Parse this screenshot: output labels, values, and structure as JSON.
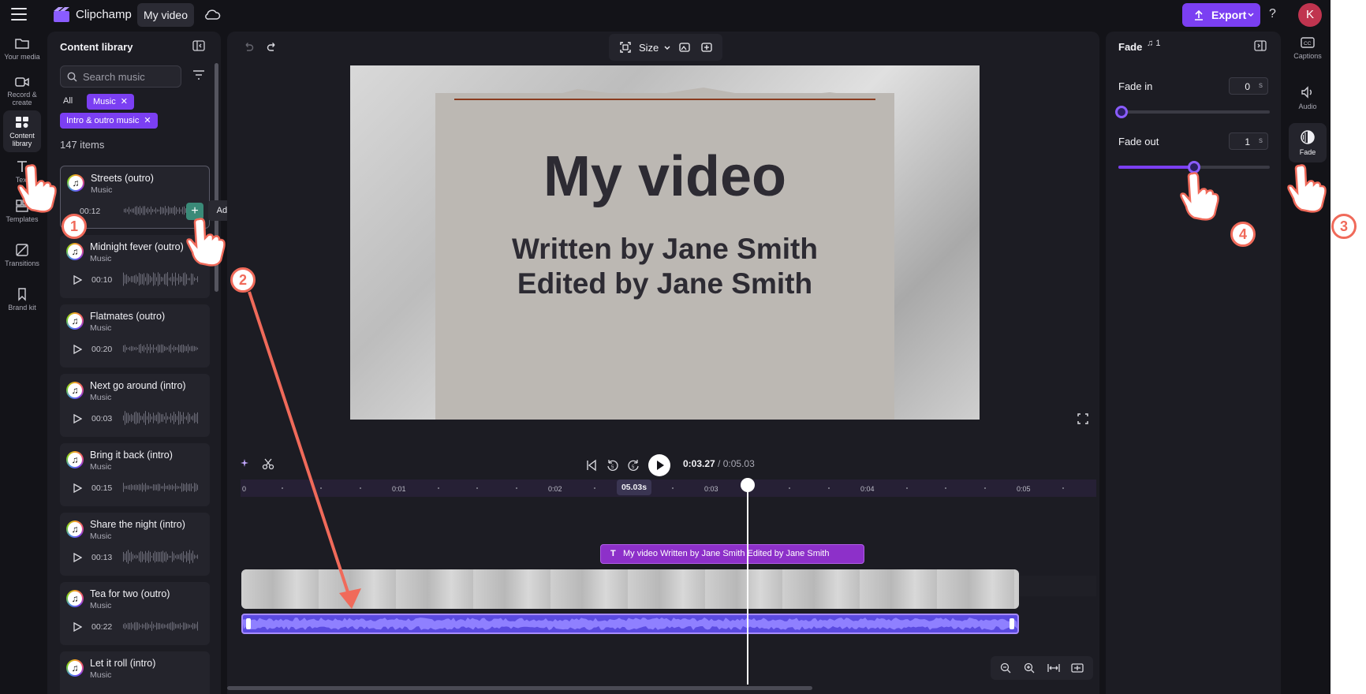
{
  "topbar": {
    "app_name": "Clipchamp",
    "project_name": "My video",
    "export_label": "Export",
    "help_label": "?",
    "avatar_initial": "K"
  },
  "left_rail": [
    {
      "label": "Your media",
      "icon": "folder-icon"
    },
    {
      "label": "Record & create",
      "icon": "camera-icon"
    },
    {
      "label": "Content library",
      "icon": "library-icon",
      "active": true
    },
    {
      "label": "Text",
      "icon": "text-icon"
    },
    {
      "label": "Templates",
      "icon": "templates-icon"
    },
    {
      "label": "Transitions",
      "icon": "transitions-icon"
    },
    {
      "label": "Brand kit",
      "icon": "brand-kit-icon"
    }
  ],
  "library": {
    "title": "Content library",
    "search_placeholder": "Search music",
    "chip_all": "All",
    "chip_music": "Music",
    "chip_intro_outro": "Intro & outro music",
    "items_count": "147 items",
    "add_tooltip": "Add to timeline",
    "tracks": [
      {
        "title": "Streets (outro)",
        "subtitle": "Music",
        "duration": "00:12"
      },
      {
        "title": "Midnight fever (outro)",
        "subtitle": "Music",
        "duration": "00:10"
      },
      {
        "title": "Flatmates (outro)",
        "subtitle": "Music",
        "duration": "00:20"
      },
      {
        "title": "Next go around (intro)",
        "subtitle": "Music",
        "duration": "00:03"
      },
      {
        "title": "Bring it back (intro)",
        "subtitle": "Music",
        "duration": "00:15"
      },
      {
        "title": "Share the night (intro)",
        "subtitle": "Music",
        "duration": "00:13"
      },
      {
        "title": "Tea for two (outro)",
        "subtitle": "Music",
        "duration": "00:22"
      },
      {
        "title": "Let it roll (intro)",
        "subtitle": "Music",
        "duration": ""
      }
    ]
  },
  "canvas": {
    "size_label": "Size",
    "preview_title": "My video",
    "preview_line1": "Written by Jane Smith",
    "preview_line2": "Edited by Jane Smith"
  },
  "timeline": {
    "current_time": "0:03.27",
    "total_time": "/ 0:05.03",
    "playhead_bubble": "05.03s",
    "ruler_ticks": [
      "0",
      "0:01",
      "0:02",
      "0:03",
      "0:04",
      "0:05"
    ],
    "text_clip_label": "My video Written by Jane Smith Edited by Jane Smith",
    "text_clip_icon": "T"
  },
  "fade_panel": {
    "title": "Fade",
    "badge_count": "1",
    "fade_in_label": "Fade in",
    "fade_in_value": "0",
    "fade_in_unit": "s",
    "fade_in_fraction": 0.0,
    "fade_out_label": "Fade out",
    "fade_out_value": "1",
    "fade_out_unit": "s",
    "fade_out_fraction": 0.5
  },
  "right_rail": [
    {
      "label": "Captions",
      "icon": "captions-icon"
    },
    {
      "label": "Audio",
      "icon": "speaker-icon"
    },
    {
      "label": "Fade",
      "icon": "fade-icon",
      "active": true
    }
  ],
  "annotations": {
    "steps": [
      "1",
      "2",
      "3",
      "4"
    ],
    "accent_color": "#f06a5a"
  },
  "colors": {
    "brand_purple": "#7b3ff2",
    "text_clip": "#8d30c9",
    "audio_clip": "#5a4ae0"
  }
}
